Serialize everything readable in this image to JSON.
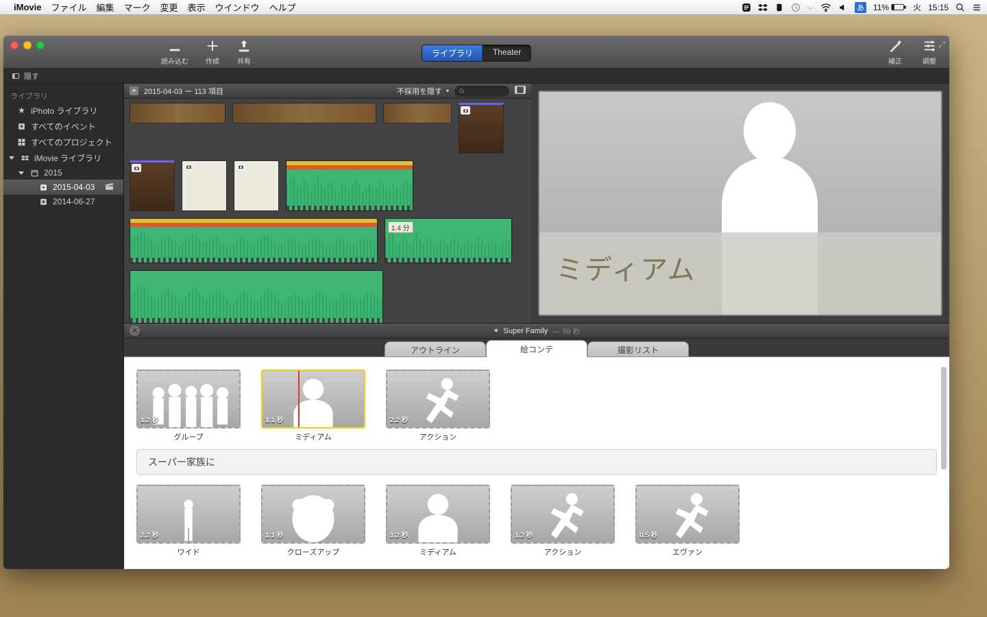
{
  "menubar": {
    "app": "iMovie",
    "items": [
      "ファイル",
      "編集",
      "マーク",
      "変更",
      "表示",
      "ウインドウ",
      "ヘルプ"
    ],
    "ime": "あ",
    "battery": "11%",
    "day": "火",
    "time": "15:15"
  },
  "toolbar": {
    "import": "読み込む",
    "create": "作成",
    "share": "共有",
    "seg": {
      "library": "ライブラリ",
      "theater": "Theater"
    },
    "enhance": "補正",
    "adjust": "調整"
  },
  "hidebar": {
    "label": "隠す"
  },
  "sidebar": {
    "section": "ライブラリ",
    "items": [
      {
        "icon": "sparkle",
        "label": "iPhoto ライブラリ"
      },
      {
        "icon": "star",
        "label": "すべてのイベント"
      },
      {
        "icon": "grid",
        "label": "すべてのプロジェクト"
      },
      {
        "icon": "lib",
        "label": "iMovie ライブラリ",
        "disclosure": "down"
      },
      {
        "icon": "cal",
        "label": "2015",
        "indent": 1,
        "disclosure": "down"
      },
      {
        "icon": "star",
        "label": "2015-04-03",
        "indent": 2,
        "selected": true,
        "extra": "clapper"
      },
      {
        "icon": "star",
        "label": "2014-06-27",
        "indent": 2
      }
    ]
  },
  "browser": {
    "title": "2015-04-03 ー 113 項目",
    "filter": "不採用を隠す",
    "clip_badge": "1.4 分"
  },
  "viewer": {
    "label": "ミディアム"
  },
  "project": {
    "name": "Super Family",
    "duration": "59 秒",
    "tabs": {
      "outline": "アウトライン",
      "storyboard": "絵コンテ",
      "shotlist": "撮影リスト"
    },
    "title_card": "スーパー家族に",
    "row1": [
      {
        "dur": "1.2 秒",
        "label": "グループ",
        "kind": "group"
      },
      {
        "dur": "1.1 秒",
        "label": "ミディアム",
        "kind": "medium",
        "sel": true,
        "marker": true
      },
      {
        "dur": "2.2 秒",
        "label": "アクション",
        "kind": "action"
      }
    ],
    "row2": [
      {
        "dur": "2.2 秒",
        "label": "ワイド",
        "kind": "wide"
      },
      {
        "dur": "1.1 秒",
        "label": "クローズアップ",
        "kind": "closeup"
      },
      {
        "dur": "1.2 秒",
        "label": "ミディアム",
        "kind": "medium"
      },
      {
        "dur": "1.2 秒",
        "label": "アクション",
        "kind": "action"
      },
      {
        "dur": "0.5 秒",
        "label": "エヴァン",
        "kind": "action"
      }
    ]
  }
}
